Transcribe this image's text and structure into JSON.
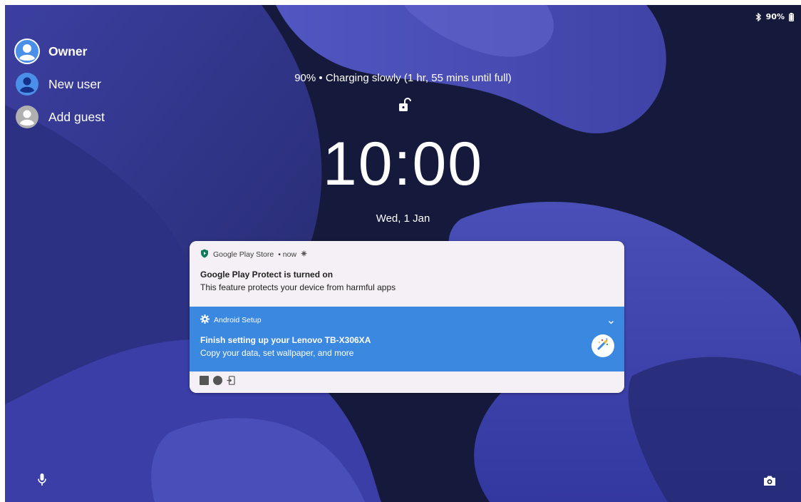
{
  "status_bar": {
    "battery_text": "90%",
    "icons": [
      "bluetooth-icon",
      "battery-icon"
    ]
  },
  "users": [
    {
      "label": "Owner",
      "icon": "user-avatar-icon",
      "active": true
    },
    {
      "label": "New user",
      "icon": "user-avatar-icon",
      "active": false
    },
    {
      "label": "Add guest",
      "icon": "guest-avatar-icon",
      "active": false
    }
  ],
  "lockscreen": {
    "charging_text": "90% • Charging slowly (1 hr, 55 mins until full)",
    "time": "10:00",
    "date": "Wed, 1 Jan",
    "lock_icon": "unlocked-padlock-icon"
  },
  "notifications": [
    {
      "app": "Google Play Store",
      "time": "• now",
      "app_icon": "play-protect-shield-icon",
      "title": "Google Play Protect is turned on",
      "text": "This feature protects your device from harmful apps"
    },
    {
      "app": "Android Setup",
      "app_icon": "gear-icon",
      "title": "Finish setting up your Lenovo TB-X306XA",
      "text": "Copy your data, set wallpaper, and more",
      "action_icon": "magic-wand-icon"
    }
  ],
  "shortcuts": {
    "left": "microphone-icon",
    "right": "camera-icon"
  },
  "colors": {
    "background_dark": "#161b3e",
    "wallpaper_purple": "#4b4fb3",
    "setup_blue": "#3b88e0",
    "notification_light": "#f5f0f5",
    "protect_green": "#0f7b5a",
    "avatar_blue": "#4a8fe8"
  }
}
